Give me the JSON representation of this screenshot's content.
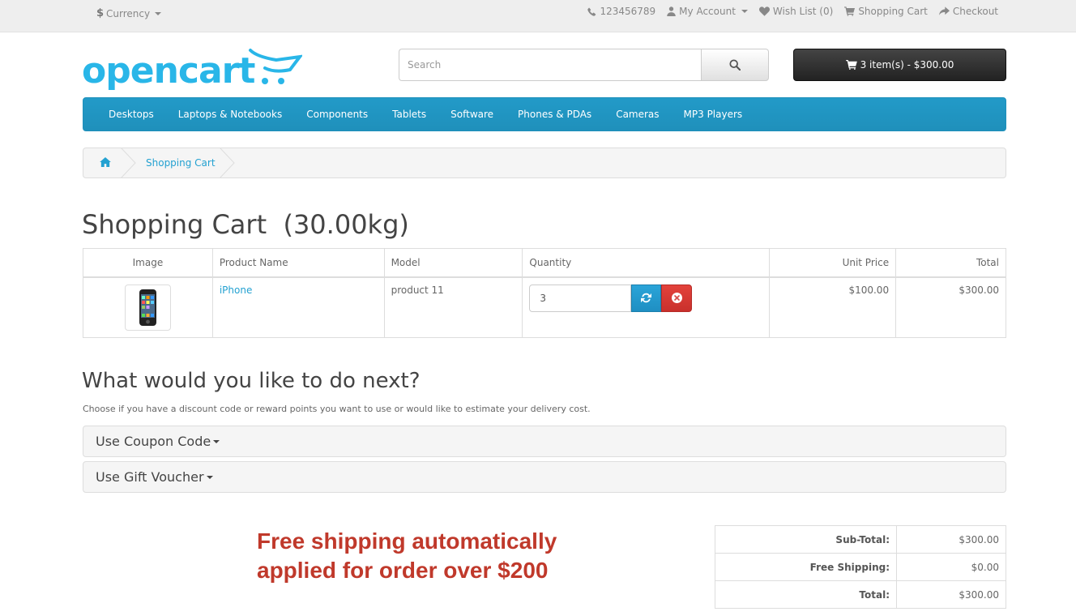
{
  "topbar": {
    "currency_symbol": "$",
    "currency_label": "Currency",
    "phone": "123456789",
    "my_account": "My Account",
    "wish_list": "Wish List (0)",
    "shopping_cart": "Shopping Cart",
    "checkout": "Checkout"
  },
  "header": {
    "logo_text": "opencart",
    "search_placeholder": "Search",
    "cart_button": "3 item(s) - $300.00"
  },
  "menu": {
    "items": [
      "Desktops",
      "Laptops & Notebooks",
      "Components",
      "Tablets",
      "Software",
      "Phones & PDAs",
      "Cameras",
      "MP3 Players"
    ]
  },
  "breadcrumb": {
    "items": [
      "Shopping Cart"
    ]
  },
  "page": {
    "title": "Shopping Cart  (30.00kg)"
  },
  "cart": {
    "headers": {
      "image": "Image",
      "name": "Product Name",
      "model": "Model",
      "quantity": "Quantity",
      "unit_price": "Unit Price",
      "total": "Total"
    },
    "rows": [
      {
        "name": "iPhone",
        "model": "product 11",
        "quantity": "3",
        "unit_price": "$100.00",
        "total": "$300.00"
      }
    ]
  },
  "next": {
    "title": "What would you like to do next?",
    "description": "Choose if you have a discount code or reward points you want to use or would like to estimate your delivery cost.",
    "coupon": "Use Coupon Code",
    "voucher": "Use Gift Voucher"
  },
  "promo": {
    "line1": "Free shipping automatically",
    "line2": "applied for order over $200"
  },
  "totals": [
    {
      "label": "Sub-Total:",
      "value": "$300.00"
    },
    {
      "label": "Free Shipping:",
      "value": "$0.00"
    },
    {
      "label": "Total:",
      "value": "$300.00"
    }
  ],
  "colors": {
    "menu_blue": "#229ac8",
    "link_blue": "#23a1d1",
    "logo_blue": "#29b6e8",
    "promo_red": "#c0392b",
    "remove_red": "#d9534f"
  }
}
